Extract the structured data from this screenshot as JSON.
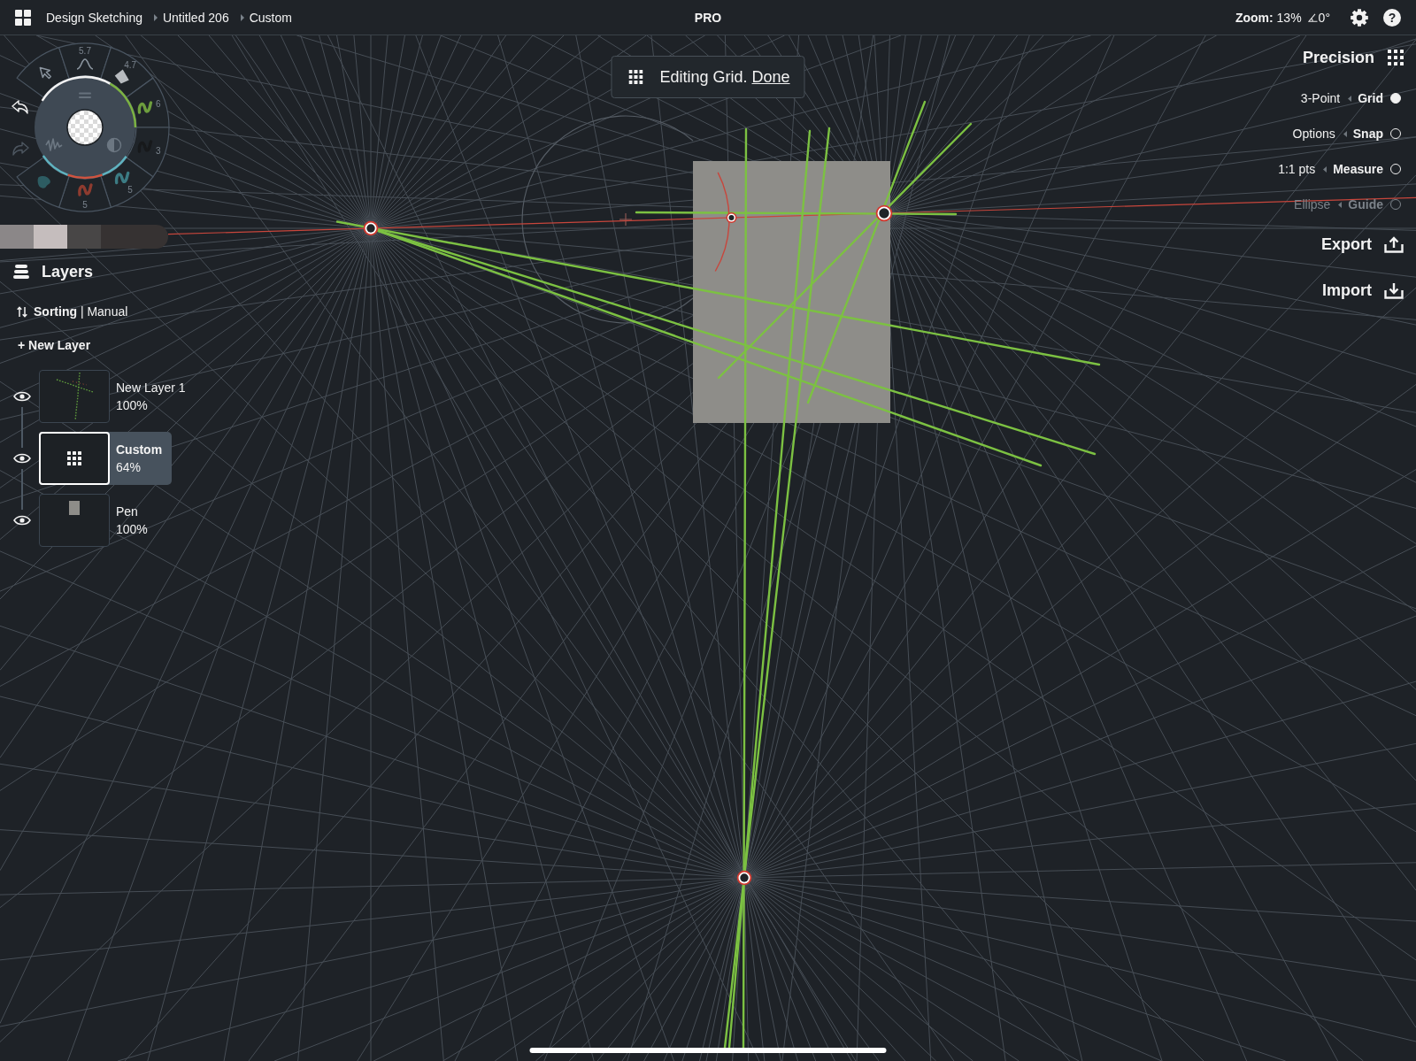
{
  "top_bar": {
    "breadcrumbs": [
      "Design Sketching",
      "Untitled 206",
      "Custom"
    ],
    "badge": "PRO",
    "zoom": "**Zoom:** 13%",
    "angle": "0°",
    "help": "?"
  },
  "tool_wheel": {
    "segments": [
      {
        "kind": "pointer"
      },
      {
        "kind": "smoothing",
        "value": "5.7"
      },
      {
        "kind": "shape",
        "value": "4.7"
      },
      {
        "kind": "brush",
        "value": "6",
        "color": "#6e9e3e"
      },
      {
        "kind": "brush",
        "value": "3",
        "color": "#17191b"
      },
      {
        "kind": "brush",
        "value": "5",
        "color": "#3c7c84"
      },
      {
        "kind": "brush",
        "value": "5",
        "color": "#8e3b2f"
      },
      {
        "kind": "blob",
        "color": "#2d5c62"
      }
    ],
    "undo": {
      "disabled": false
    },
    "redo": {
      "disabled": true
    }
  },
  "swatches": [
    {
      "color": "#8b8788"
    },
    {
      "color": "#c5bdbd"
    },
    {
      "color": "#484646"
    },
    {
      "color": "#363232"
    }
  ],
  "layers_panel": {
    "title": "Layers",
    "sorting": "**Sorting** | Manual",
    "new_layer": "+ New Layer",
    "layers": [
      {
        "kind": "sketch",
        "name": "New Layer 1",
        "opacity": "100%",
        "visible": true,
        "selected": false
      },
      {
        "kind": "grid",
        "name": "Custom",
        "opacity": "64%",
        "visible": true,
        "selected": true
      },
      {
        "kind": "photo",
        "name": "Pen",
        "opacity": "100%",
        "visible": true,
        "selected": false
      }
    ]
  },
  "grid_banner": {
    "message": "Editing Grid.",
    "action": "Done"
  },
  "precision_panel": {
    "title": "Precision",
    "modes": [
      {
        "option": "3-Point",
        "label": "Grid",
        "on": true,
        "disabled": false
      },
      {
        "option": "Options",
        "label": "Snap",
        "on": false,
        "disabled": false
      },
      {
        "option": "1:1 pts",
        "label": "Measure",
        "on": false,
        "disabled": false
      },
      {
        "option": "Ellipse",
        "label": "Guide",
        "on": false,
        "disabled": true
      }
    ],
    "actions": [
      {
        "kind": "export",
        "label": "Export"
      },
      {
        "kind": "import",
        "label": "Import"
      }
    ]
  }
}
